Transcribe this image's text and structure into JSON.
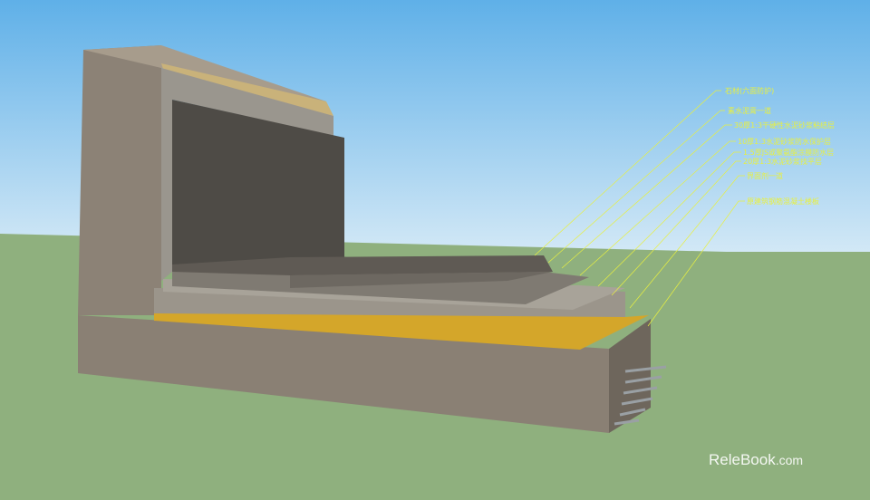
{
  "labels": [
    "石材(六面防护)",
    "素水泥膏一道",
    "30厚1:3干硬性水泥砂浆粘结层",
    "10厚1:3水泥砂浆防水保护层",
    "1.5厚JS或聚氨酯涂膜防水层",
    "20厚1:3水泥砂浆找平层",
    "界面剂一道",
    "原建筑钢筋混凝土楼板"
  ],
  "watermark": {
    "brand": "ReleBook",
    "suffix": ".com"
  },
  "colors": {
    "sky_top": "#5fb0e8",
    "sky_bottom": "#cfe6f5",
    "ground": "#8fb07e",
    "concrete": "#8c8276",
    "stone": "#5a5650",
    "waterproof": "#d4a62a",
    "leader": "#e8f040"
  }
}
